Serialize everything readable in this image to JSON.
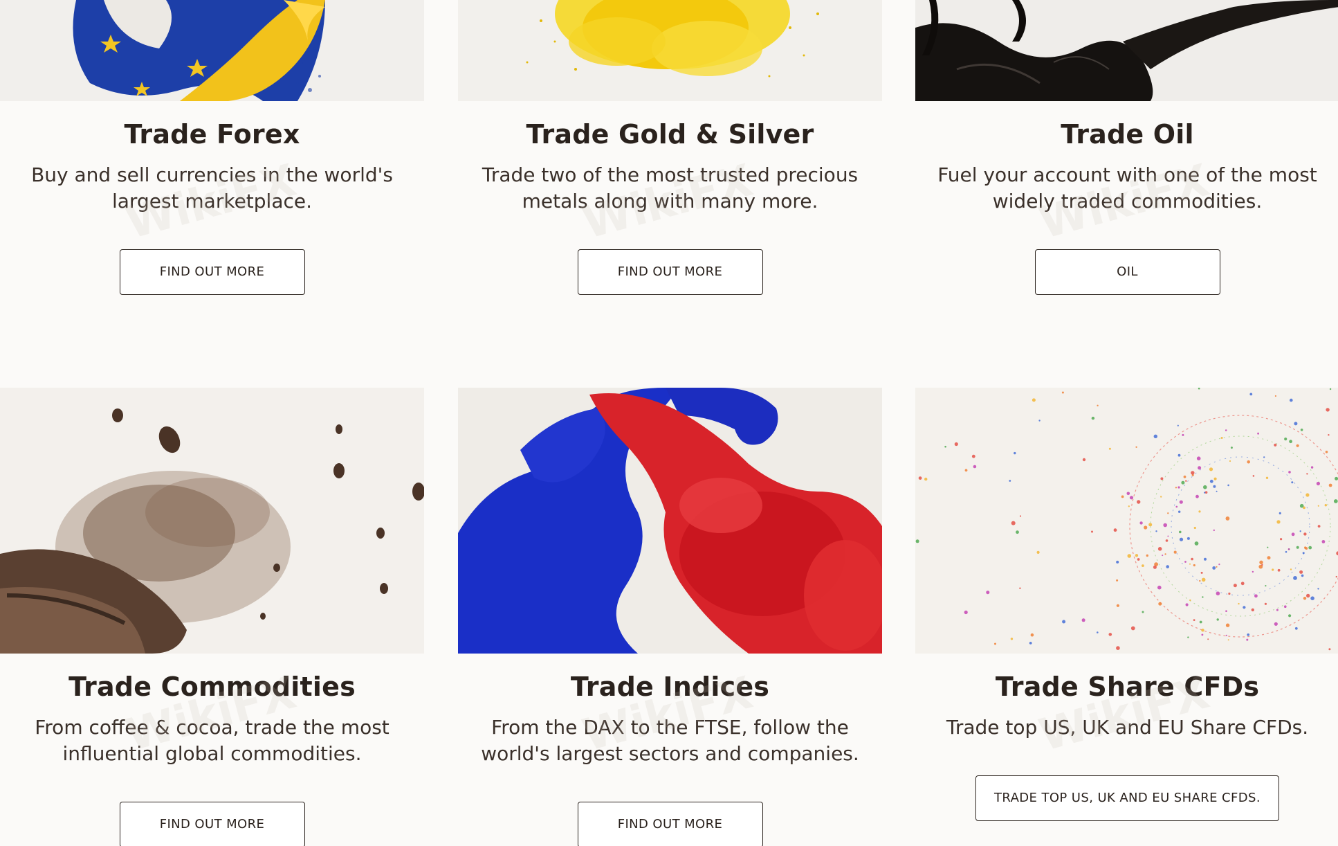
{
  "cards": [
    {
      "title": "Trade Forex",
      "description": "Buy and sell currencies in the world's largest marketplace.",
      "cta": "FIND OUT MORE",
      "image": "eu-flag-splash-image"
    },
    {
      "title": "Trade Gold & Silver",
      "description": "Trade two of the most trusted precious metals along with many more.",
      "cta": "FIND OUT MORE",
      "image": "gold-powder-explosion-image"
    },
    {
      "title": "Trade Oil",
      "description": "Fuel your account with one of the most widely traded commodities.",
      "cta": "OIL",
      "image": "black-oil-splash-image"
    },
    {
      "title": "Trade Commodities",
      "description": "From coffee & cocoa, trade the most influential global commodities.",
      "cta": "FIND OUT MORE",
      "image": "coffee-bean-burst-image"
    },
    {
      "title": "Trade Indices",
      "description": "From the DAX to the FTSE, follow the world's largest sectors and companies.",
      "cta": "FIND OUT MORE",
      "image": "blue-red-ink-smoke-image"
    },
    {
      "title": "Trade Share CFDs",
      "description": "Trade top US, UK and EU Share CFDs.",
      "cta": "TRADE TOP US, UK AND EU SHARE CFDS.",
      "image": "network-sphere-dots-image"
    }
  ],
  "watermark": "WikiFX",
  "colors": {
    "background": "#fbfaf8",
    "text": "#2a221d",
    "button_border": "#2a221d"
  }
}
